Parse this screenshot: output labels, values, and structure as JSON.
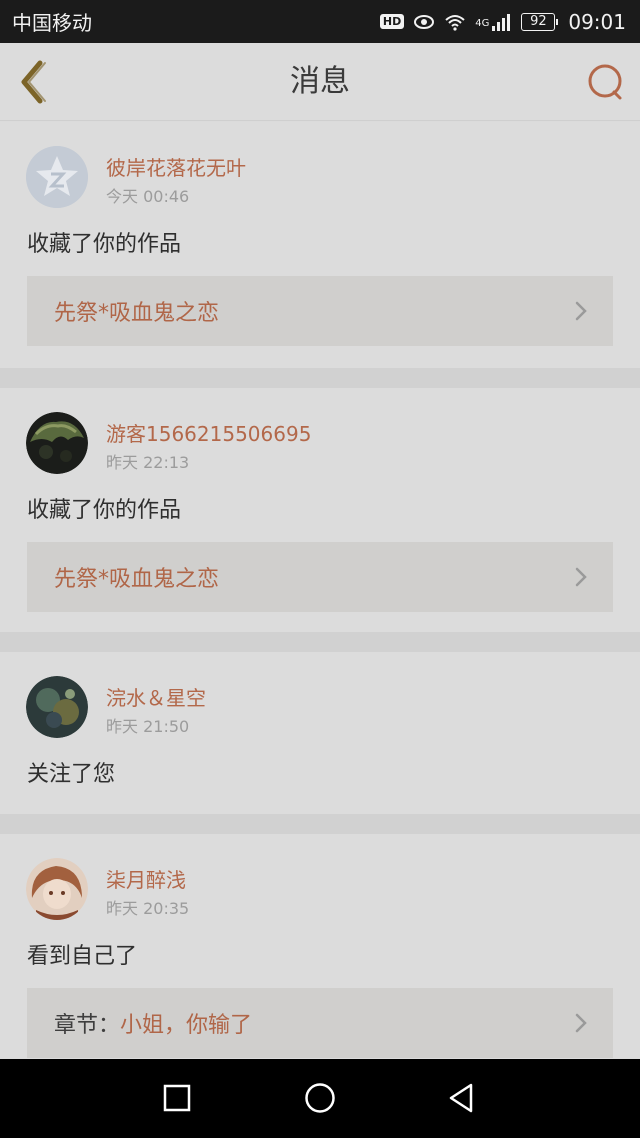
{
  "status_bar": {
    "carrier": "中国移动",
    "hd": "HD",
    "network": "4G",
    "battery": "92",
    "time": "09:01"
  },
  "header": {
    "title": "消息"
  },
  "colors": {
    "accent": "#b3684a",
    "header_bg": "#dcdcdc",
    "nav_bg": "#000000"
  },
  "messages": [
    {
      "user": "彼岸花落花无叶",
      "time": "今天 00:46",
      "action": "收藏了你的作品",
      "work": "先祭*吸血鬼之恋"
    },
    {
      "user": "游客1566215506695",
      "time": "昨天 22:13",
      "action": "收藏了你的作品",
      "work": "先祭*吸血鬼之恋"
    },
    {
      "user": "浣水＆星空",
      "time": "昨天 21:50",
      "action": "关注了您"
    },
    {
      "user": "柒月醉浅",
      "time": "昨天 20:35",
      "action": "看到自己了",
      "chapter_prefix": "章节：",
      "chapter": "小姐，你输了"
    }
  ],
  "nav": {
    "recent_icon": "square-icon",
    "home_icon": "circle-icon",
    "back_icon": "triangle-back-icon"
  }
}
